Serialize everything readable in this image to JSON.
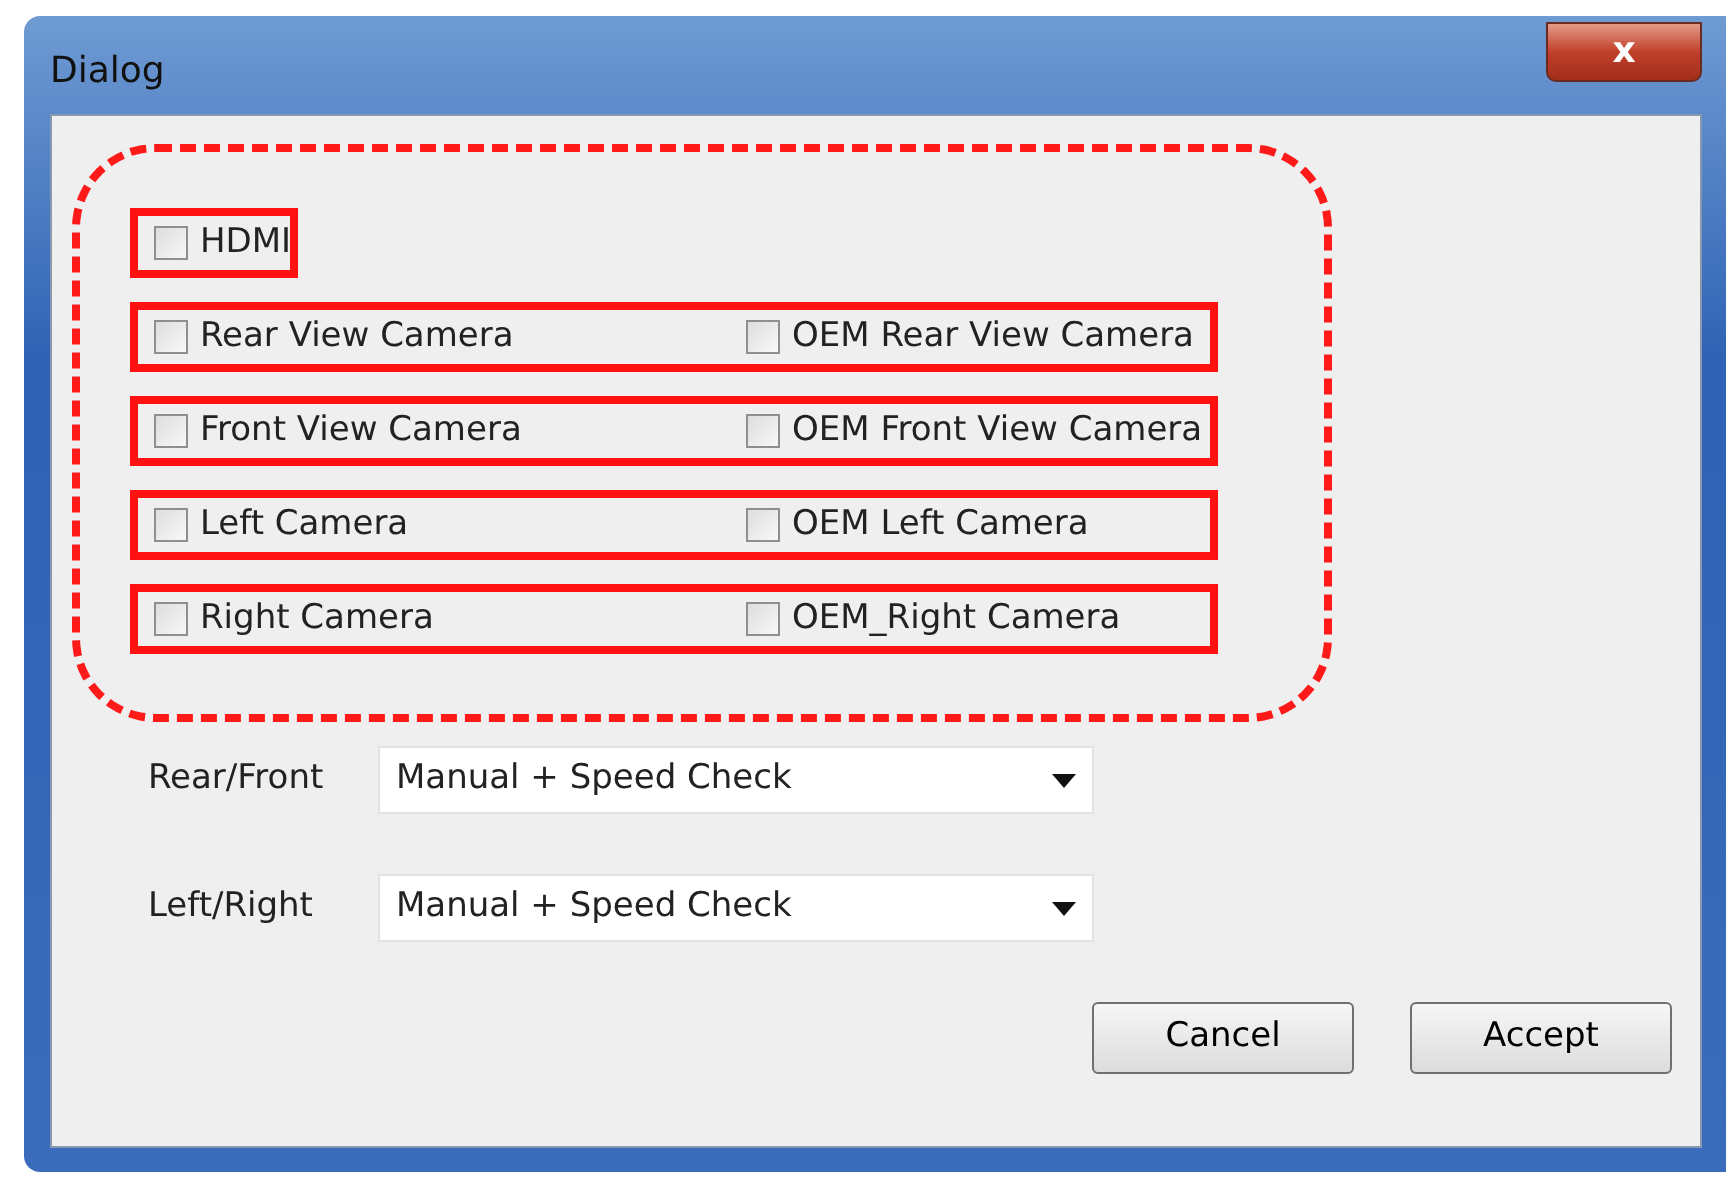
{
  "window": {
    "title": "Dialog",
    "close_label": "x"
  },
  "checkbox_groups": [
    {
      "highlighted": true,
      "items": [
        {
          "label": "HDMI",
          "checked": false
        }
      ]
    },
    {
      "highlighted": true,
      "items": [
        {
          "label": "Rear View Camera",
          "checked": false
        },
        {
          "label": "OEM Rear View Camera",
          "checked": false
        }
      ]
    },
    {
      "highlighted": true,
      "items": [
        {
          "label": "Front View Camera",
          "checked": false
        },
        {
          "label": "OEM Front View Camera",
          "checked": false
        }
      ]
    },
    {
      "highlighted": true,
      "items": [
        {
          "label": "Left Camera",
          "checked": false
        },
        {
          "label": "OEM Left Camera",
          "checked": false
        }
      ]
    },
    {
      "highlighted": true,
      "items": [
        {
          "label": "Right Camera",
          "checked": false
        },
        {
          "label": "OEM_Right Camera",
          "checked": false
        }
      ]
    }
  ],
  "dropdowns": [
    {
      "label": "Rear/Front",
      "value": "Manual + Speed Check"
    },
    {
      "label": "Left/Right",
      "value": "Manual + Speed Check"
    }
  ],
  "buttons": [
    "Cancel",
    "Accept"
  ]
}
